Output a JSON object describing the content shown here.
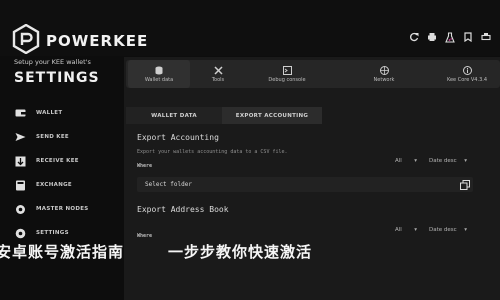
{
  "header": {
    "brand": "POWERKEE"
  },
  "sidebar": {
    "subtitle": "Setup your KEE wallet's",
    "title": "SETTINGS",
    "items": [
      {
        "label": "WALLET",
        "icon": "wallet-icon"
      },
      {
        "label": "SEND KEE",
        "icon": "send-icon"
      },
      {
        "label": "RECEIVE KEE",
        "icon": "receive-icon"
      },
      {
        "label": "EXCHANGE",
        "icon": "exchange-icon"
      },
      {
        "label": "MASTER NODES",
        "icon": "nodes-icon"
      },
      {
        "label": "SETTINGS",
        "icon": "gear-icon"
      }
    ]
  },
  "toolbar": {
    "items": [
      {
        "label": "Wallet data",
        "icon": "database-icon"
      },
      {
        "label": "Tools",
        "icon": "tools-icon"
      },
      {
        "label": "Debug console",
        "icon": "terminal-icon"
      },
      {
        "label": "Network",
        "icon": "network-icon"
      },
      {
        "label": "Kee Core V4.3.4",
        "icon": "info-icon"
      }
    ]
  },
  "tabs": {
    "wallet_data": "WALLET DATA",
    "export_accounting": "EXPORT ACCOUNTING"
  },
  "export_accounting": {
    "title": "Export Accounting",
    "description": "Export your wallets accounting data to a CSV file.",
    "where_label": "Where",
    "filter_value": "All",
    "sort_value": "Date desc",
    "folder_value": "Select folder"
  },
  "export_address_book": {
    "title": "Export Address Book",
    "where_label": "Where",
    "filter_value": "All",
    "sort_value": "Date desc"
  },
  "banner": {
    "left": "安卓账号激活指南",
    "right": "一步步教你快速激活"
  },
  "colors": {
    "background": "#0d0d0d",
    "panel": "#1a1a1a",
    "toolbar": "#262626"
  }
}
